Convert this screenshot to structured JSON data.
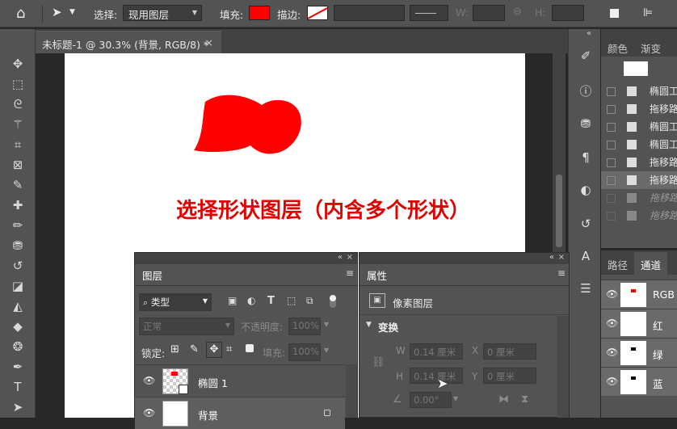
{
  "options_bar": {
    "select_label": "选择:",
    "select_value": "现用图层",
    "fill_label": "填充:",
    "stroke_label": "描边:",
    "w_label": "W:",
    "h_label": "H:",
    "fill_color": "#ff0000"
  },
  "document": {
    "tab_title": "未标题-1 @ 30.3% (背景, RGB/8) *",
    "annotation": "选择形状图层（内含多个形状）",
    "shape_color": "#ff0000",
    "annotation_color": "#e00000"
  },
  "history_panel": {
    "tabs": [
      "颜色",
      "渐变"
    ],
    "items": [
      "椭圆工",
      "拖移路",
      "椭圆工",
      "椭圆工",
      "拖移路",
      "拖移路",
      "拖移路",
      "拖移路"
    ]
  },
  "channels_panel": {
    "tabs": [
      "路径",
      "通道"
    ],
    "channels": [
      "RGB",
      "红",
      "绿",
      "蓝"
    ]
  },
  "layers_panel": {
    "title": "图层",
    "filter_kind": "类型",
    "blend_mode": "正常",
    "opacity_label": "不透明度:",
    "opacity_value": "100%",
    "lock_label": "锁定:",
    "fill_label": "填充:",
    "fill_value": "100%",
    "layers": [
      "椭圆 1",
      "背景"
    ]
  },
  "properties_panel": {
    "title": "属性",
    "type_label": "像素图层",
    "section": "变换",
    "w_label": "W",
    "w_value": "0.14 厘米",
    "x_label": "X",
    "x_value": "0 厘米",
    "h_label": "H",
    "h_value": "0.14 厘米",
    "y_label": "Y",
    "y_value": "0 厘米",
    "angle_value": "0.00°"
  }
}
